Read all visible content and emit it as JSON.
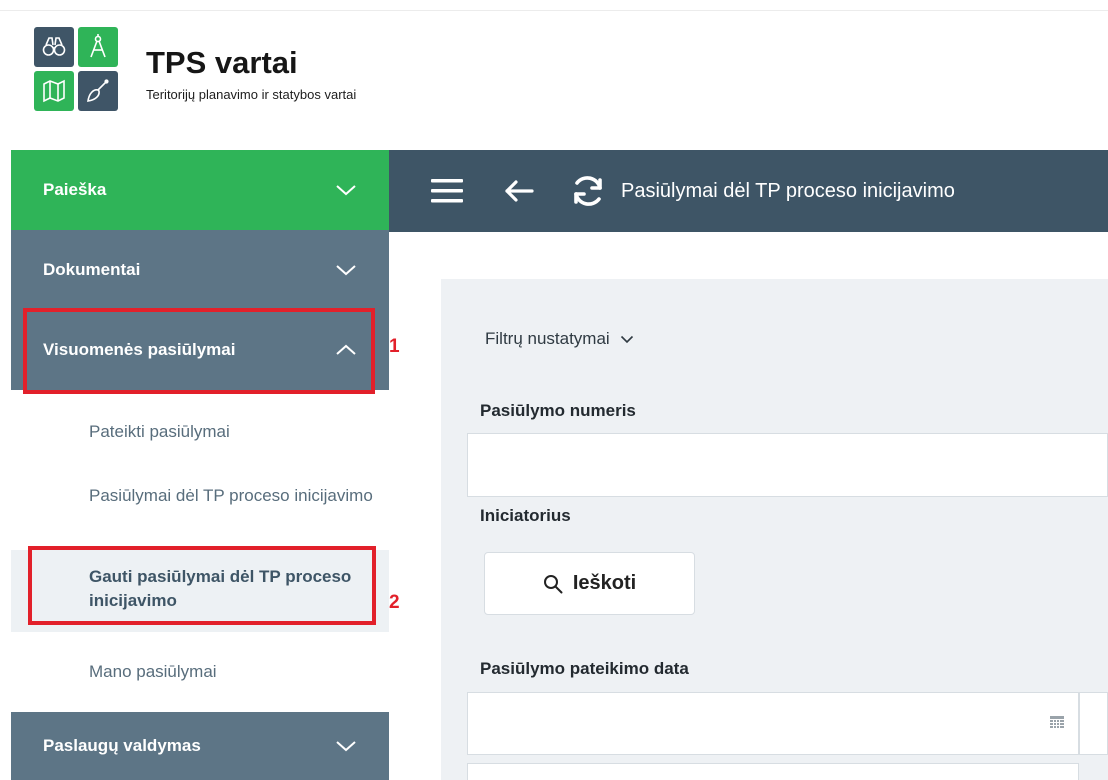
{
  "brand": {
    "title": "TPS vartai",
    "subtitle": "Teritorijų planavimo ir statybos vartai",
    "logo_icons": [
      "binoculars-icon",
      "compass-icon",
      "map-icon",
      "trowel-icon"
    ]
  },
  "sidebar": {
    "sections": {
      "search": "Paieška",
      "documents": "Dokumentai",
      "public_proposals": "Visuomenės pasiūlymai",
      "services": "Paslaugų valdymas"
    },
    "items": [
      "Pateikti pasiūlymai",
      "Pasiūlymai dėl TP proceso inicijavimo",
      "Gauti pasiūlymai dėl TP proceso inicijavimo",
      "Mano pasiūlymai"
    ],
    "active_item_index": 2
  },
  "annotations": {
    "marker_1": "1",
    "marker_2": "2"
  },
  "topbar": {
    "title": "Pasiūlymai dėl TP proceso inicijavimo"
  },
  "filters": {
    "toggle_label": "Filtrų nustatymai",
    "proposal_number_label": "Pasiūlymo numeris",
    "proposal_number_value": "",
    "initiator_label": "Iniciatorius",
    "search_button_label": "Ieškoti",
    "submission_date_label": "Pasiūlymo pateikimo data",
    "submission_date_value": ""
  },
  "colors": {
    "brand_green": "#2fb458",
    "slate_dark": "#3e5566",
    "slate_mid": "#5d7586",
    "highlight_red": "#e2202a",
    "panel_bg": "#eef1f4"
  }
}
